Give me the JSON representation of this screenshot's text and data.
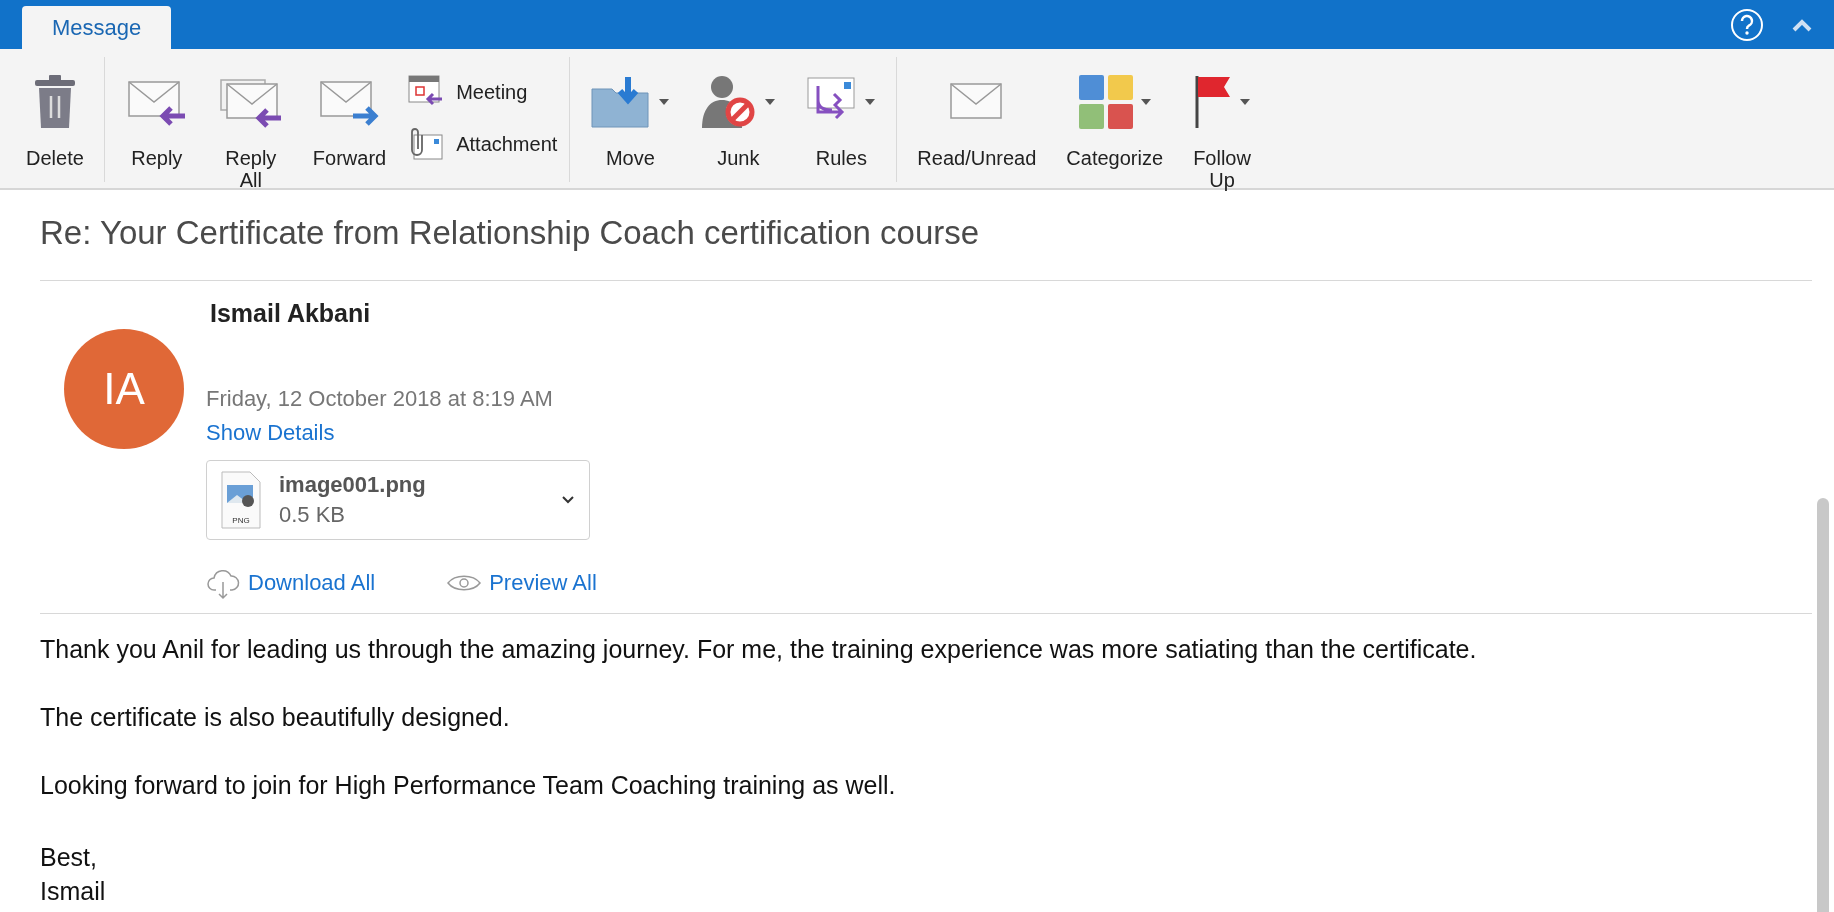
{
  "tabs": [
    {
      "label": "Message",
      "selected": true
    }
  ],
  "ribbon": {
    "groups": [
      {
        "items": [
          {
            "kind": "large",
            "label": "Delete",
            "dropdown": false
          }
        ]
      },
      {
        "items": [
          {
            "kind": "large",
            "label": "Reply",
            "dropdown": false
          },
          {
            "kind": "large",
            "label": "Reply All",
            "dropdown": false
          },
          {
            "kind": "large",
            "label": "Forward",
            "dropdown": false
          },
          {
            "kind": "small",
            "label": "Meeting"
          },
          {
            "kind": "small",
            "label": "Attachment"
          }
        ]
      },
      {
        "items": [
          {
            "kind": "large",
            "label": "Move",
            "dropdown": true
          },
          {
            "kind": "large",
            "label": "Junk",
            "dropdown": true
          },
          {
            "kind": "large",
            "label": "Rules",
            "dropdown": true
          }
        ]
      },
      {
        "items": [
          {
            "kind": "large",
            "label": "Read/Unread",
            "dropdown": false
          },
          {
            "kind": "large",
            "label": "Categorize",
            "dropdown": true
          },
          {
            "kind": "large",
            "label": "Follow Up",
            "dropdown": true
          }
        ]
      }
    ]
  },
  "message": {
    "subject": "Re: Your Certificate from Relationship Coach certification course",
    "sender": {
      "initials": "IA",
      "name": "Ismail Akbani",
      "color": "#e06837"
    },
    "date": "Friday, 12 October 2018 at 8:19 AM",
    "show_details": "Show Details",
    "attachments": [
      {
        "name": "image001.png",
        "size": "0.5 KB",
        "type": "PNG"
      }
    ],
    "attachment_actions": [
      "Download All",
      "Preview All"
    ],
    "body": [
      "Thank you Anil for leading us through the amazing journey. For me, the training experience was more satiating than the certificate.",
      "The certificate is also beautifully designed.",
      "Looking forward to join for High Performance Team Coaching training as well."
    ],
    "signature": [
      "Best,",
      "Ismail"
    ]
  }
}
